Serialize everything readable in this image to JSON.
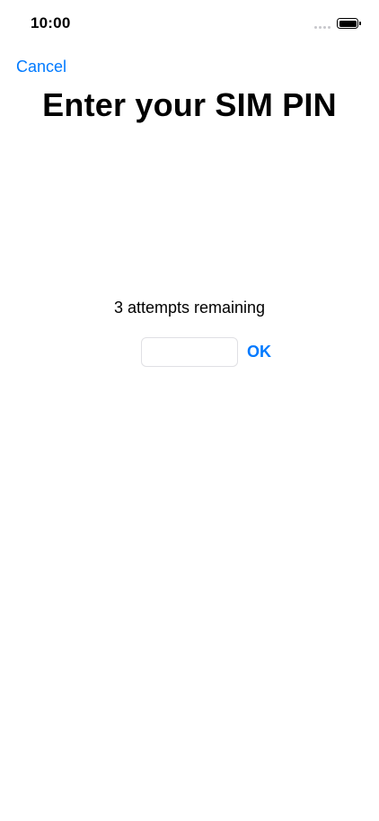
{
  "status_bar": {
    "time": "10:00",
    "signal_icon": "cellular-signal-icon",
    "battery_icon": "battery-icon",
    "battery_level": 1.0
  },
  "nav": {
    "cancel_label": "Cancel"
  },
  "page": {
    "title": "Enter your SIM PIN",
    "attempts_text": "3 attempts remaining"
  },
  "pin_entry": {
    "value": "",
    "placeholder": ""
  },
  "actions": {
    "ok_label": "OK"
  },
  "colors": {
    "accent": "#007aff",
    "text": "#000000",
    "background": "#ffffff",
    "input_border": "#e0e0e4"
  }
}
